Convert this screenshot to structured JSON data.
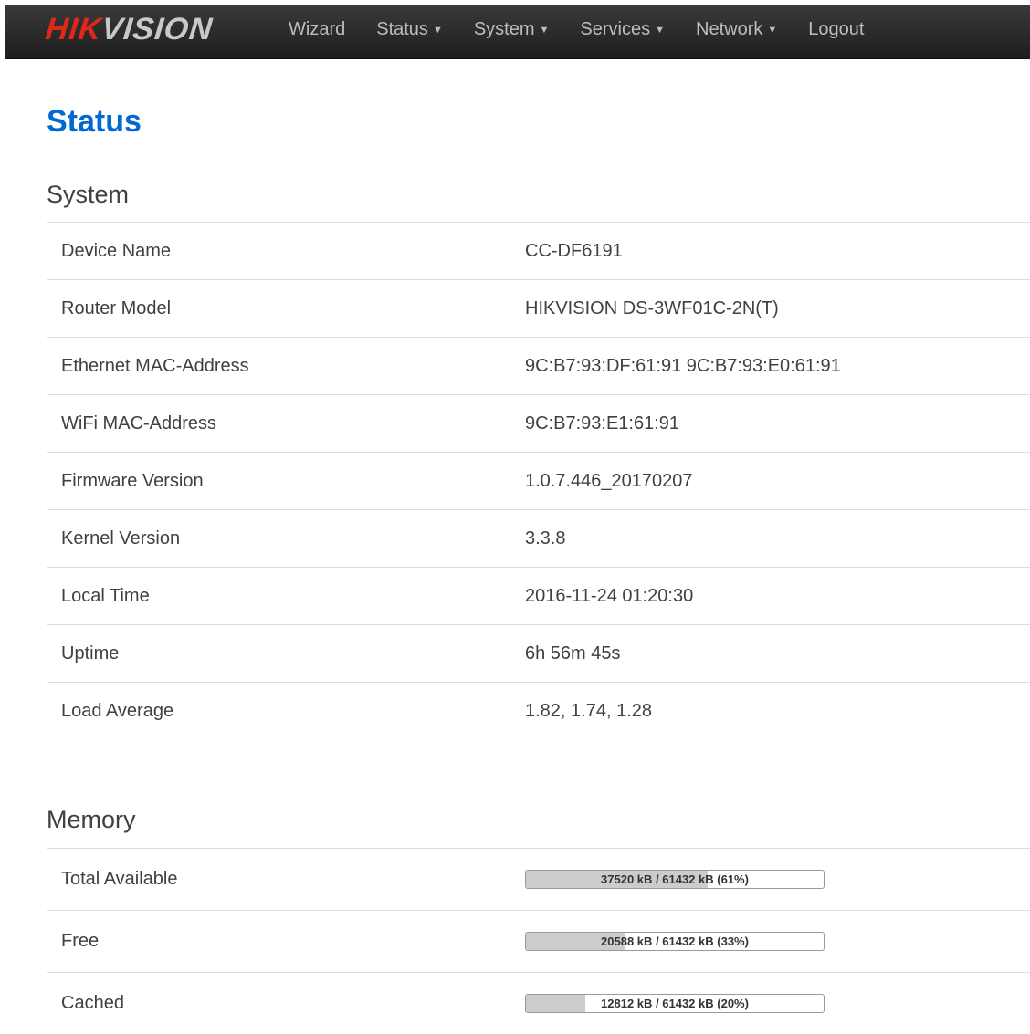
{
  "navbar": {
    "brand_red": "HIK",
    "brand_grey": "VISION",
    "items": [
      {
        "label": "Wizard",
        "dropdown": false
      },
      {
        "label": "Status",
        "dropdown": true
      },
      {
        "label": "System",
        "dropdown": true
      },
      {
        "label": "Services",
        "dropdown": true
      },
      {
        "label": "Network",
        "dropdown": true
      },
      {
        "label": "Logout",
        "dropdown": false
      }
    ],
    "caret": "▼"
  },
  "page_title": "Status",
  "system": {
    "title": "System",
    "rows": [
      {
        "key": "Device Name",
        "value": "CC-DF6191"
      },
      {
        "key": "Router Model",
        "value": "HIKVISION DS-3WF01C-2N(T)"
      },
      {
        "key": "Ethernet MAC-Address",
        "value": "9C:B7:93:DF:61:91 9C:B7:93:E0:61:91"
      },
      {
        "key": "WiFi MAC-Address",
        "value": "9C:B7:93:E1:61:91"
      },
      {
        "key": "Firmware Version",
        "value": "1.0.7.446_20170207"
      },
      {
        "key": "Kernel Version",
        "value": "3.3.8"
      },
      {
        "key": "Local Time",
        "value": "2016-11-24 01:20:30"
      },
      {
        "key": "Uptime",
        "value": "6h 56m 45s"
      },
      {
        "key": "Load Average",
        "value": "1.82, 1.74, 1.28"
      }
    ]
  },
  "memory": {
    "title": "Memory",
    "rows": [
      {
        "key": "Total Available",
        "text": "37520 kB / 61432 kB (61%)",
        "percent": 61
      },
      {
        "key": "Free",
        "text": "20588 kB / 61432 kB (33%)",
        "percent": 33
      },
      {
        "key": "Cached",
        "text": "12812 kB / 61432 kB (20%)",
        "percent": 20
      }
    ]
  },
  "colors": {
    "brand_red": "#e1261c",
    "title_blue": "#0069d6",
    "navbar_bg": "#2b2b2b",
    "bar_fill": "#cccccc"
  }
}
